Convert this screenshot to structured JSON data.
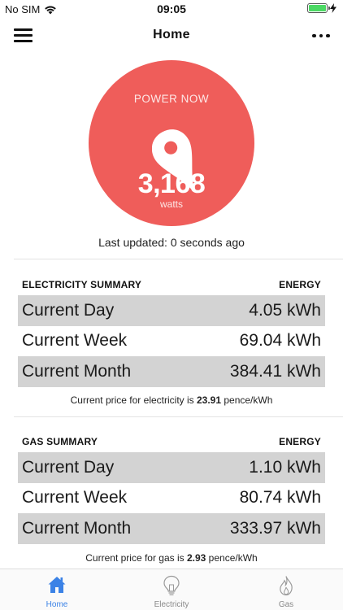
{
  "status_bar": {
    "carrier": "No SIM",
    "time": "09:05"
  },
  "nav": {
    "title": "Home"
  },
  "power": {
    "label": "POWER NOW",
    "value": "3,168",
    "unit": "watts",
    "last_updated": "Last updated: 0 seconds ago"
  },
  "electricity": {
    "title": "ELECTRICITY SUMMARY",
    "column": "ENERGY",
    "rows": [
      {
        "label": "Current Day",
        "value": "4.05 kWh"
      },
      {
        "label": "Current Week",
        "value": "69.04 kWh"
      },
      {
        "label": "Current Month",
        "value": "384.41 kWh"
      }
    ],
    "price_prefix": "Current price for electricity is ",
    "price_value": "23.91",
    "price_suffix": " pence/kWh"
  },
  "gas": {
    "title": "GAS SUMMARY",
    "column": "ENERGY",
    "rows": [
      {
        "label": "Current Day",
        "value": "1.10 kWh"
      },
      {
        "label": "Current Week",
        "value": "80.74 kWh"
      },
      {
        "label": "Current Month",
        "value": "333.97 kWh"
      }
    ],
    "price_prefix": "Current price for gas is ",
    "price_value": "2.93",
    "price_suffix": " pence/kWh"
  },
  "tabs": [
    {
      "label": "Home",
      "icon": "home-icon",
      "active": true
    },
    {
      "label": "Electricity",
      "icon": "lightbulb-icon",
      "active": false
    },
    {
      "label": "Gas",
      "icon": "flame-icon",
      "active": false
    }
  ],
  "colors": {
    "accent": "#3b82e6",
    "power_circle": "#ef5d5a",
    "row_shade": "#d3d3d3",
    "battery": "#4cd964"
  }
}
